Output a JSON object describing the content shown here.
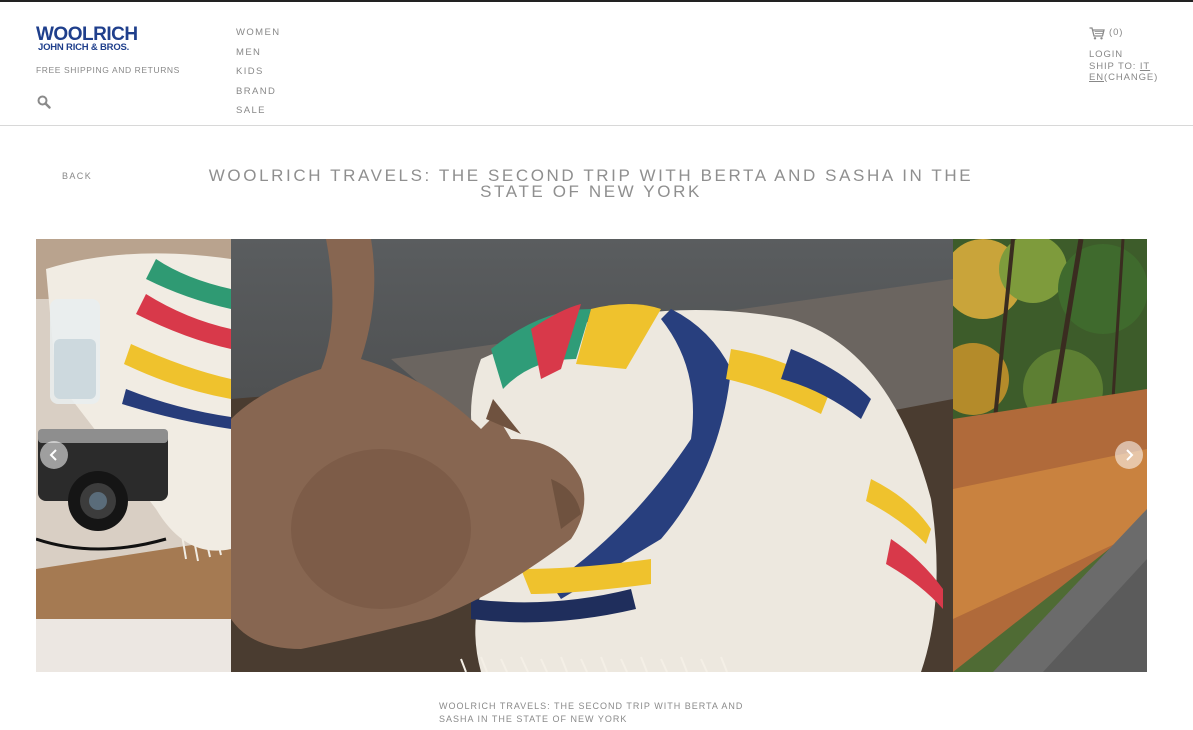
{
  "header": {
    "logo_main": "WOOLRICH",
    "logo_sub": "JOHN RICH & BROS.",
    "tagline": "FREE SHIPPING AND RETURNS",
    "search_icon": "search-icon"
  },
  "nav": {
    "items": [
      "WOMEN",
      "MEN",
      "KIDS",
      "BRAND",
      "SALE"
    ]
  },
  "utility": {
    "cart_count": "(0)",
    "login": "LOGIN",
    "ship_to_label": "SHIP TO:",
    "ship_country": "IT",
    "language": "EN",
    "change": "(CHANGE)"
  },
  "page": {
    "back_label": "BACK",
    "title": "WOOLRICH TRAVELS: THE SECOND TRIP WITH BERTA AND SASHA IN THE STATE OF NEW YORK",
    "caption": "WOOLRICH TRAVELS: THE SECOND TRIP WITH BERTA AND SASHA IN THE STATE OF NEW YORK"
  },
  "gallery": {
    "slides": [
      "camera-and-blanket-photo",
      "cat-with-striped-blanket-photo",
      "autumn-road-photo"
    ],
    "prev_icon": "chevron-left-icon",
    "next_icon": "chevron-right-icon"
  },
  "colors": {
    "brand": "#1f3f8c",
    "text": "#888888",
    "divider": "#d8d8d8"
  }
}
